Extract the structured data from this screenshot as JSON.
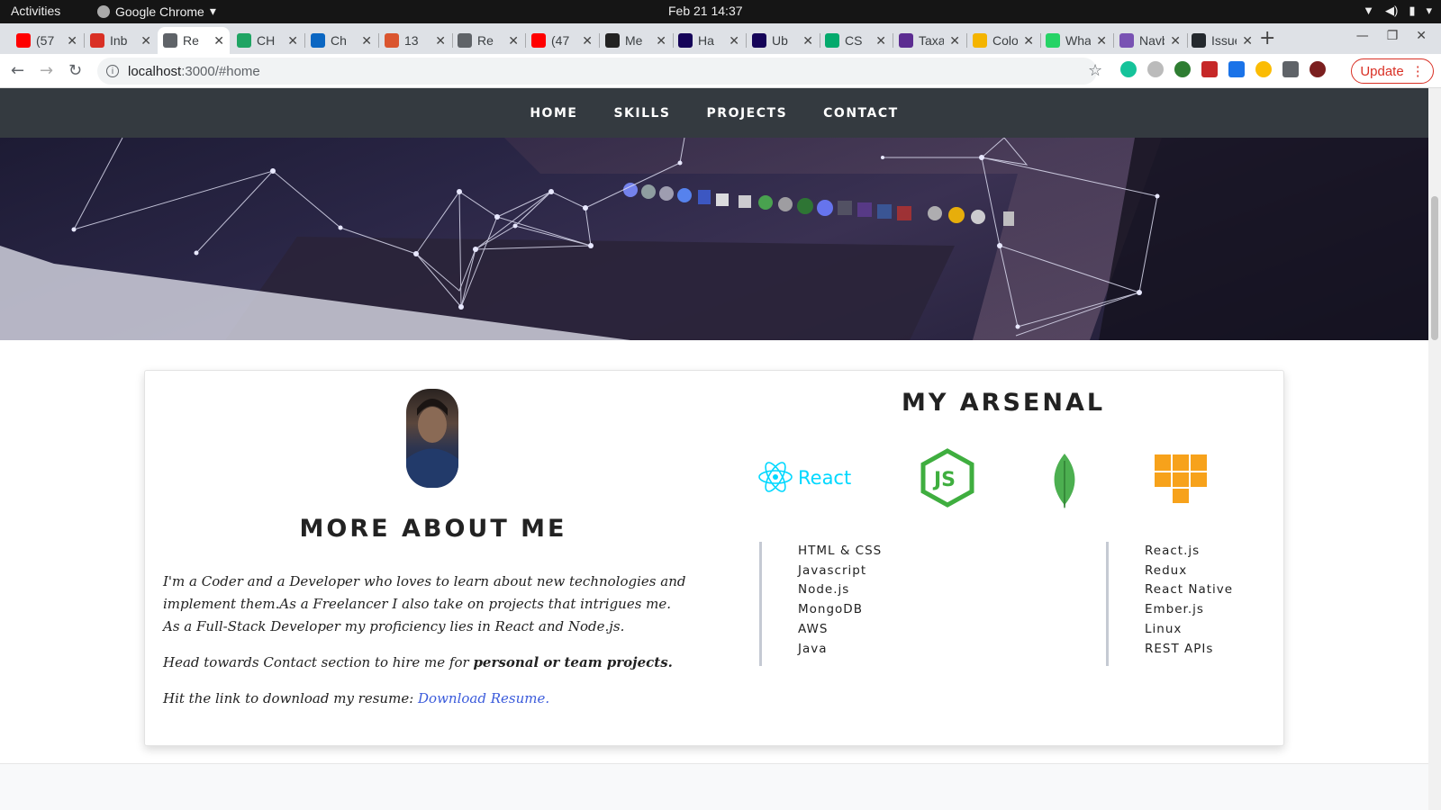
{
  "os_bar": {
    "activities": "Activities",
    "app": "Google Chrome",
    "clock": "Feb 21  14:37"
  },
  "tabs": [
    {
      "label": "(57",
      "icon": "youtube-icon",
      "color": "#ff0000"
    },
    {
      "label": "Inb",
      "icon": "gmail-icon",
      "color": "#d93025"
    },
    {
      "label": "Re",
      "icon": "globe-icon",
      "color": "#5f6368",
      "active": true
    },
    {
      "label": "CH",
      "icon": "drive-icon",
      "color": "#1fa463"
    },
    {
      "label": "Ch",
      "icon": "linkedin-icon",
      "color": "#0a66c2"
    },
    {
      "label": "13",
      "icon": "producthunt-icon",
      "color": "#da552f"
    },
    {
      "label": "Re",
      "icon": "globe-icon",
      "color": "#5f6368"
    },
    {
      "label": "(47",
      "icon": "youtube-icon",
      "color": "#ff0000"
    },
    {
      "label": "Me",
      "icon": "medium-icon",
      "color": "#222"
    },
    {
      "label": "Ha",
      "icon": "pandas-icon",
      "color": "#150458"
    },
    {
      "label": "Ub",
      "icon": "pandas-icon",
      "color": "#150458"
    },
    {
      "label": "CS",
      "icon": "w3schools-icon",
      "color": "#04aa6d"
    },
    {
      "label": "Taxar",
      "icon": "taxonomy-icon",
      "color": "#5c2d91"
    },
    {
      "label": "Color",
      "icon": "cup-icon",
      "color": "#f4b400"
    },
    {
      "label": "Whats",
      "icon": "whatsapp-icon",
      "color": "#25d366"
    },
    {
      "label": "Navba",
      "icon": "bootstrap-icon",
      "color": "#7952b3"
    },
    {
      "label": "Issues",
      "icon": "github-icon",
      "color": "#24292e"
    }
  ],
  "toolbar": {
    "url_host": "localhost",
    "url_path": ":3000/#home",
    "update_label": "Update"
  },
  "site": {
    "nav": [
      "HOME",
      "SKILLS",
      "PROJECTS",
      "CONTACT"
    ],
    "about_title": "MORE ABOUT ME",
    "bio_line1": "I'm a Coder and a Developer who loves to learn about new technologies and implement them.As a Freelancer I also take on projects that intrigues me.",
    "bio_line2": "As a Full-Stack Developer my proficiency lies in React and Node.js.",
    "bio_contact_prefix": "Head towards Contact section to hire me for ",
    "bio_contact_bold": "personal or team projects.",
    "bio_resume_prefix": "Hit the link to download my resume: ",
    "bio_resume_link": "Download Resume.",
    "arsenal_title": "MY ARSENAL",
    "react_logo_text": "React",
    "skills_left": [
      "HTML & CSS",
      "Javascript",
      "Node.js",
      "MongoDB",
      "AWS",
      "Java"
    ],
    "skills_right": [
      "React.js",
      "Redux",
      "React Native",
      "Ember.js",
      "Linux",
      "REST APIs"
    ]
  },
  "colors": {
    "navbar": "#343a40",
    "react": "#00d8ff",
    "node": "#3fae3f",
    "mongo": "#4caf50",
    "aws": "#f7a21b",
    "link": "#3b5bdb"
  }
}
